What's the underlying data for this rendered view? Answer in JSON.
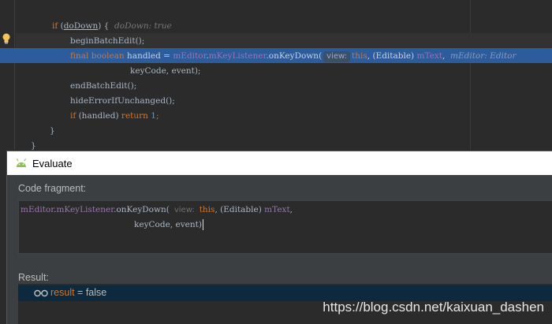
{
  "editor": {
    "lines": {
      "if_kw": "if",
      "if_rest_open": " (",
      "if_var": "doDown",
      "if_rest_close": ") {",
      "if_debug": "doDown: true",
      "begin_batch": "beginBatchEdit();",
      "final_kw": "final",
      "boolean_kw": "boolean",
      "handled_assign": " handled = ",
      "m_editor": "mEditor",
      "dot1": ".",
      "m_key_listener": "mKeyListener",
      "on_key_down": ".onKeyDown(",
      "hint_view": "view:",
      "this_kw": "this",
      "editable_cast": ", (Editable) ",
      "m_text": "mText",
      "comma": ",",
      "debug_tail": "mEditor: Editor",
      "keycode_event": "keyCode, event);",
      "end_batch": "endBatchEdit();",
      "hide_error": "hideErrorIfUnchanged();",
      "if2_kw": "if",
      "if2_mid": " (handled) ",
      "return_kw": "return",
      "return_val": "1",
      "semicolon": ";",
      "close_brace_inner": "}",
      "close_brace_outer": "}"
    }
  },
  "dialog": {
    "title": "Evaluate",
    "code_fragment_label": "Code fragment:",
    "fragment": {
      "m_editor": "mEditor",
      "dot": ".",
      "m_key_listener": "mKeyListener",
      "on_key_down": ".onKeyDown(",
      "hint_view": "view:",
      "this_kw": "this",
      "editable_cast": ", (Editable) ",
      "m_text": "mText",
      "comma": ",",
      "line2": "keyCode, event)"
    },
    "result_label": "Result:",
    "result": {
      "name": "result",
      "equals": " = ",
      "value": "false"
    }
  },
  "watermark": "https://blog.csdn.net/kaixuan_dashen",
  "colors": {
    "editor_bg": "#2b2b2b",
    "execution_line": "#2d5c9d",
    "keyword": "#cc7832",
    "field": "#9876aa",
    "number": "#6897bb",
    "result_row": "#0d293e"
  }
}
